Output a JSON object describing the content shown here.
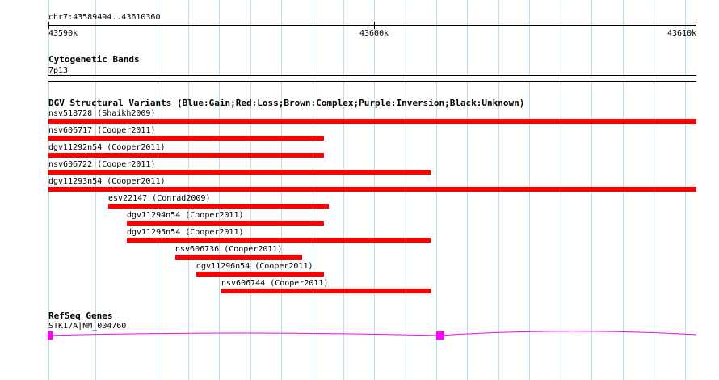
{
  "ruler": {
    "range_label": "chr7:43589494..43610360",
    "ticks": [
      "43590k",
      "43600k",
      "43610k"
    ]
  },
  "cytoband": {
    "title": "Cytogenetic Bands",
    "band_label": "7p13"
  },
  "dgv": {
    "title": "DGV Structural Variants (Blue:Gain;Red:Loss;Brown:Complex;Purple:Inversion;Black:Unknown)",
    "loss_color": "#ff0000",
    "variants": [
      {
        "label": "nsv518728 (Shaikh2009)"
      },
      {
        "label": "nsv606717 (Cooper2011)"
      },
      {
        "label": "dgv11292n54 (Cooper2011)"
      },
      {
        "label": "nsv606722 (Cooper2011)"
      },
      {
        "label": "dgv11293n54 (Cooper2011)"
      },
      {
        "label": "esv22147 (Conrad2009)"
      },
      {
        "label": "dgv11294n54 (Cooper2011)"
      },
      {
        "label": "dgv11295n54 (Cooper2011)"
      },
      {
        "label": "nsv606736 (Cooper2011)"
      },
      {
        "label": "dgv11296n54 (Cooper2011)"
      },
      {
        "label": "nsv606744 (Cooper2011)"
      }
    ]
  },
  "refseq": {
    "title": "RefSeq Genes",
    "gene_label": "STK17A|NM_004760",
    "gene_color": "#ff00ff"
  },
  "colors": {
    "grid": "#b8dcf2",
    "loss": "#ff0000",
    "gene": "#ff00ff"
  }
}
